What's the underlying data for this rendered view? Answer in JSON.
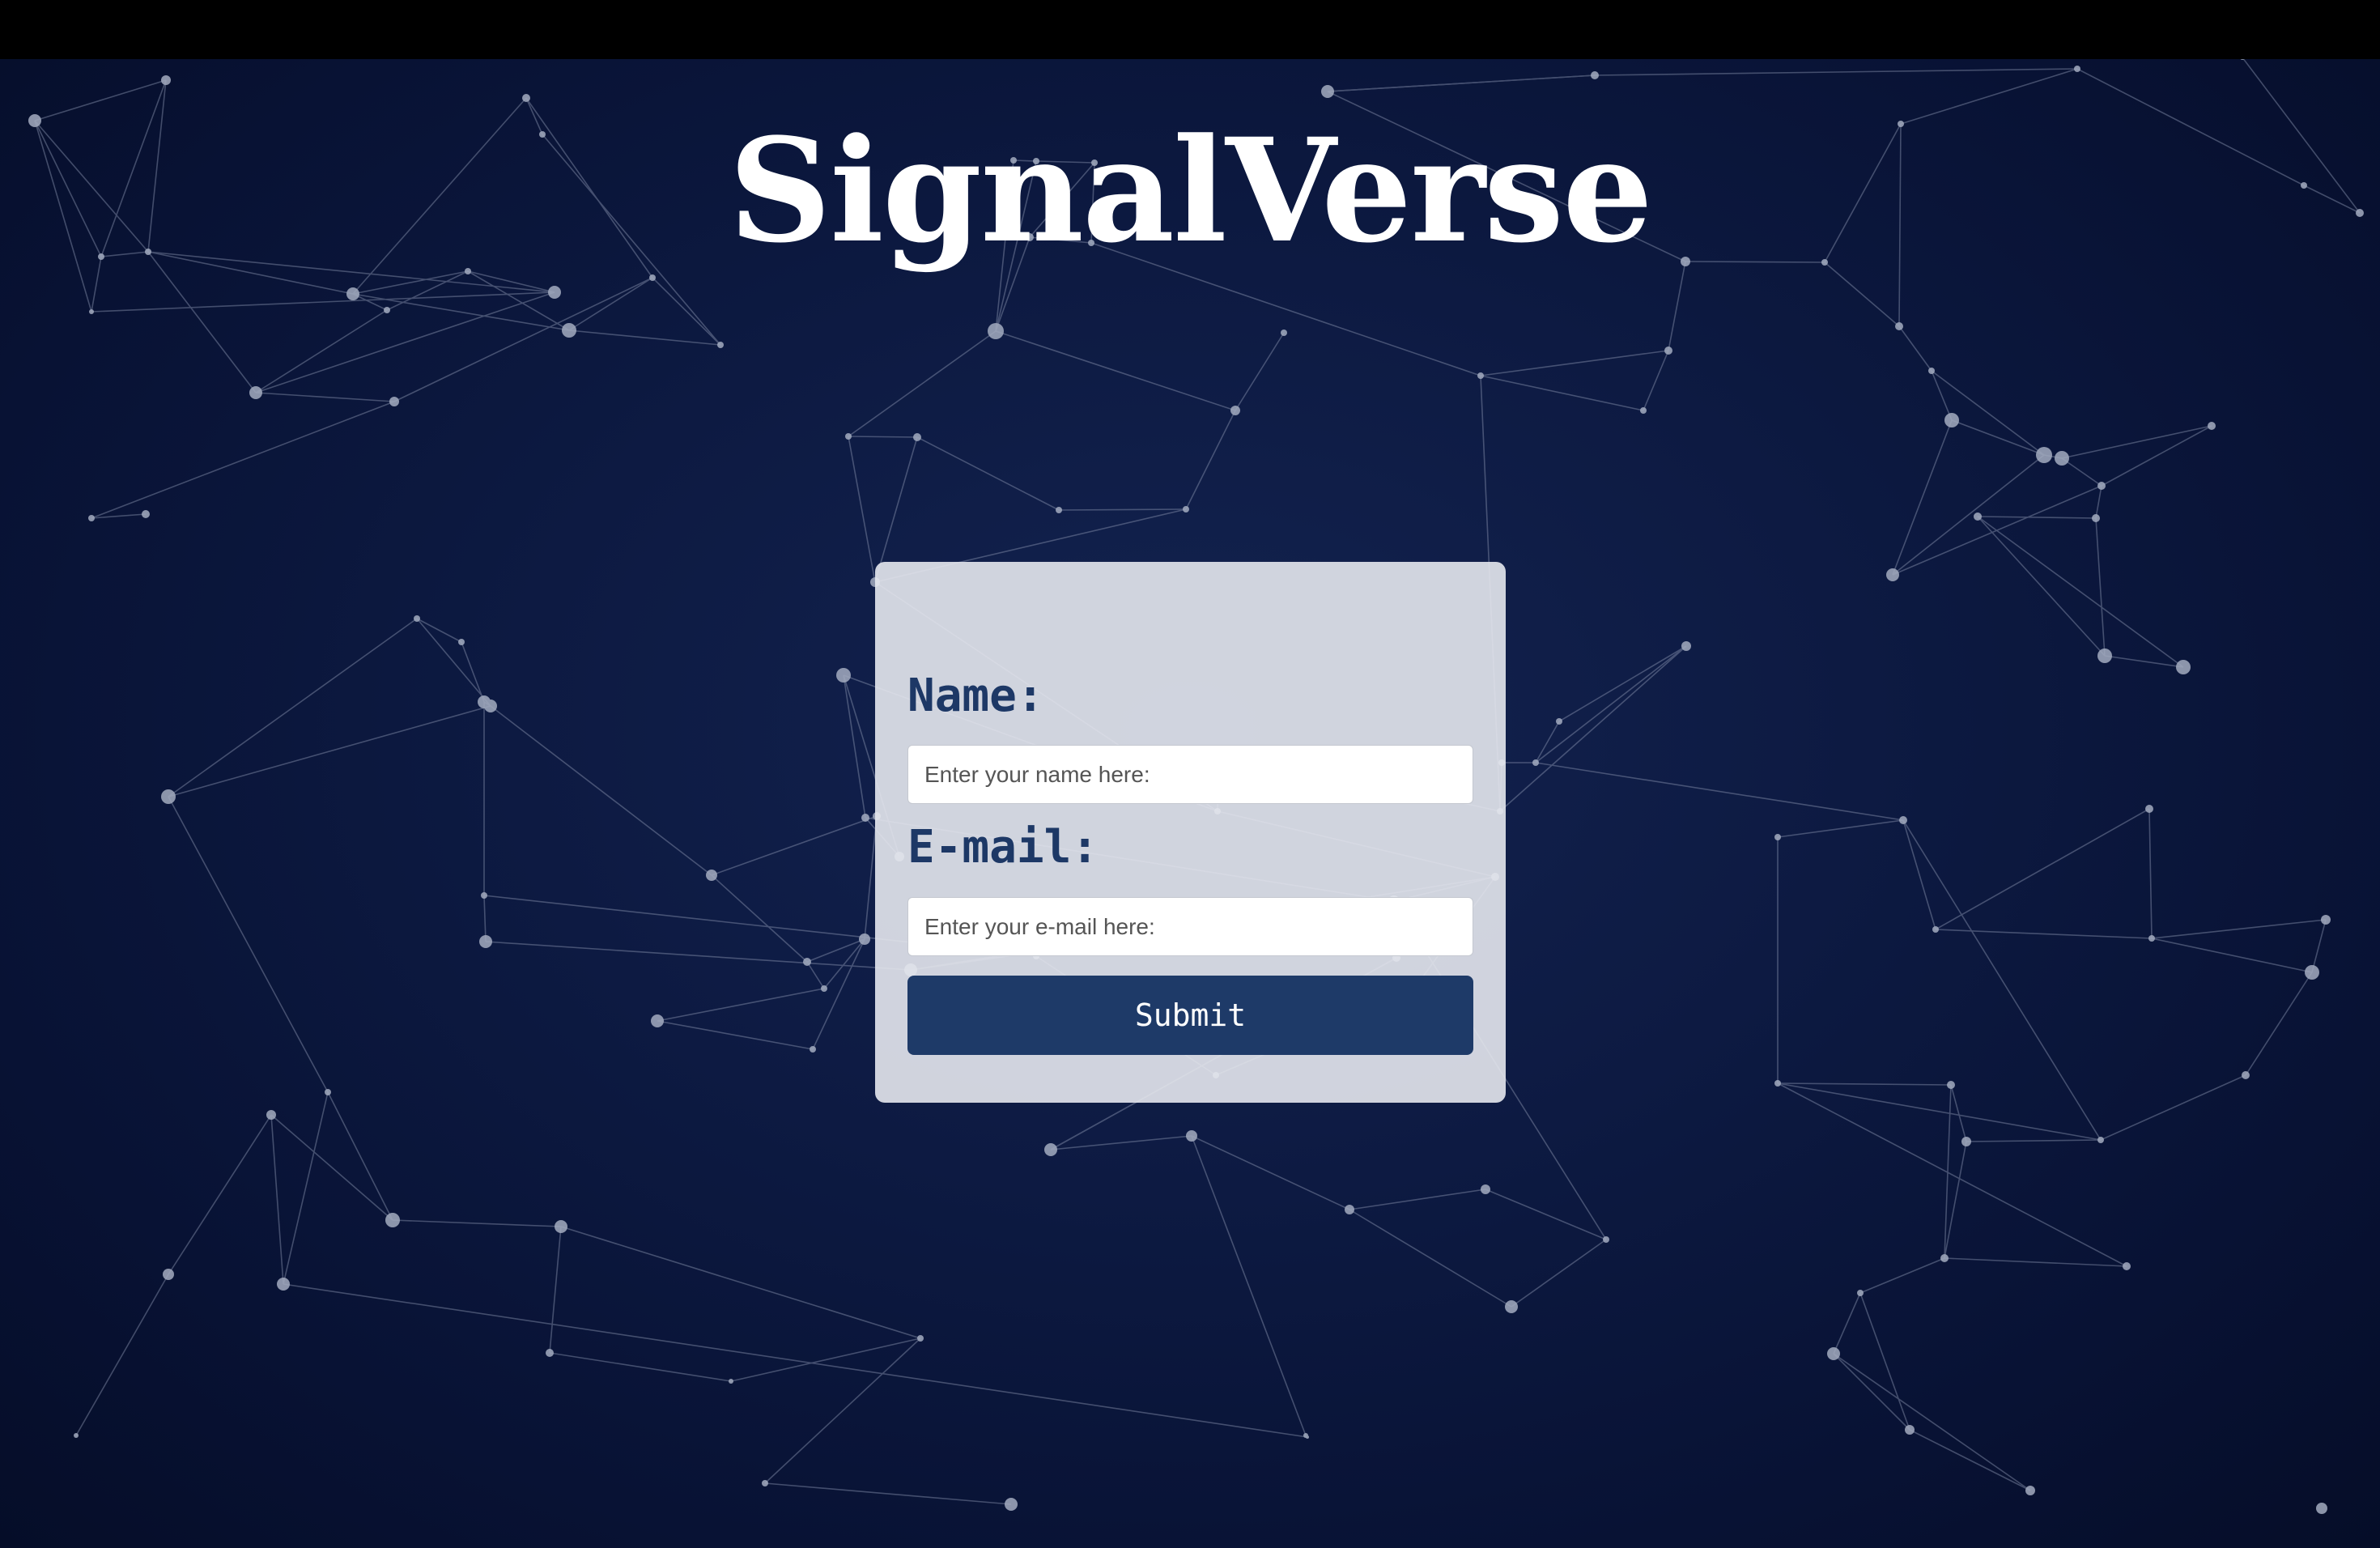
{
  "app": {
    "title": "SignalVerse"
  },
  "form": {
    "name_label": "Name:",
    "name_placeholder": "Enter your name here:",
    "name_value": "",
    "email_label": "E-mail:",
    "email_placeholder": "Enter your e-mail here:",
    "email_value": "",
    "submit_label": "Submit"
  },
  "colors": {
    "background": "#0d1a42",
    "title": "#ffffff",
    "label": "#1d3866",
    "button": "#1e3a68",
    "card": "#e6e8ee",
    "network_node": "#9aa3b8",
    "network_line": "#6f7a96"
  },
  "icons": {
    "background_decoration": "network-graph"
  }
}
